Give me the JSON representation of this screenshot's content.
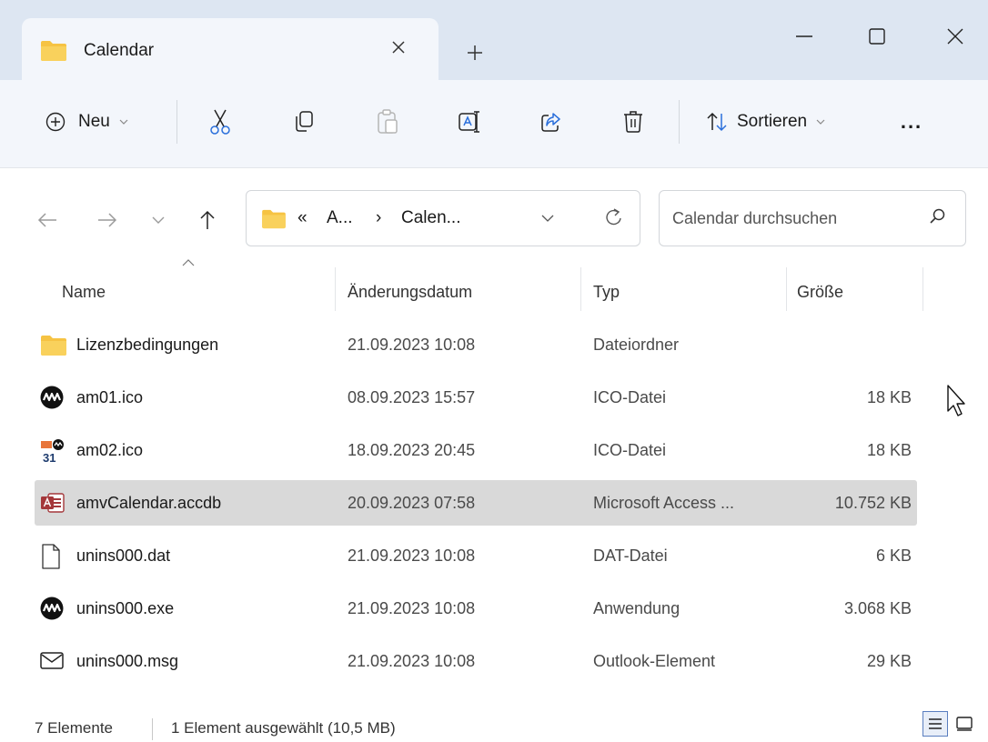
{
  "window": {
    "tab_title": "Calendar",
    "tab_close_icon": "close-icon",
    "new_tab_icon": "plus-icon",
    "controls": [
      "minimize-icon",
      "maximize-icon",
      "close-icon"
    ]
  },
  "toolbar": {
    "new_label": "Neu",
    "sort_label": "Sortieren",
    "more_label": "...",
    "icons": [
      "cut-icon",
      "copy-icon",
      "paste-icon",
      "rename-icon",
      "share-icon",
      "delete-icon"
    ]
  },
  "address": {
    "overflow": "«",
    "crumbs": [
      "A...",
      "Calen..."
    ],
    "separator": "›"
  },
  "search": {
    "placeholder": "Calendar durchsuchen"
  },
  "columns": {
    "name": "Name",
    "date": "Änderungsdatum",
    "type": "Typ",
    "size": "Größe"
  },
  "files": [
    {
      "name": "Lizenzbedingungen",
      "date": "21.09.2023 10:08",
      "type": "Dateiordner",
      "size": "",
      "icon": "folder-icon",
      "selected": false
    },
    {
      "name": "am01.ico",
      "date": "08.09.2023 15:57",
      "type": "ICO-Datei",
      "size": "18 KB",
      "icon": "am-logo-icon",
      "selected": false
    },
    {
      "name": "am02.ico",
      "date": "18.09.2023 20:45",
      "type": "ICO-Datei",
      "size": "18 KB",
      "icon": "calendar-31-icon",
      "selected": false
    },
    {
      "name": "amvCalendar.accdb",
      "date": "20.09.2023 07:58",
      "type": "Microsoft Access ...",
      "size": "10.752 KB",
      "icon": "access-db-icon",
      "selected": true
    },
    {
      "name": "unins000.dat",
      "date": "21.09.2023 10:08",
      "type": "DAT-Datei",
      "size": "6 KB",
      "icon": "file-icon",
      "selected": false
    },
    {
      "name": "unins000.exe",
      "date": "21.09.2023 10:08",
      "type": "Anwendung",
      "size": "3.068 KB",
      "icon": "am-logo-icon",
      "selected": false
    },
    {
      "name": "unins000.msg",
      "date": "21.09.2023 10:08",
      "type": "Outlook-Element",
      "size": "29 KB",
      "icon": "mail-icon",
      "selected": false
    }
  ],
  "status": {
    "count": "7 Elemente",
    "selection": "1 Element ausgewählt (10,5 MB)"
  },
  "colors": {
    "titlebar": "#dde6f2",
    "commandbar": "#f3f6fb",
    "selection": "#d9d9d9",
    "folder": "#f6c343",
    "access": "#a4373a"
  }
}
